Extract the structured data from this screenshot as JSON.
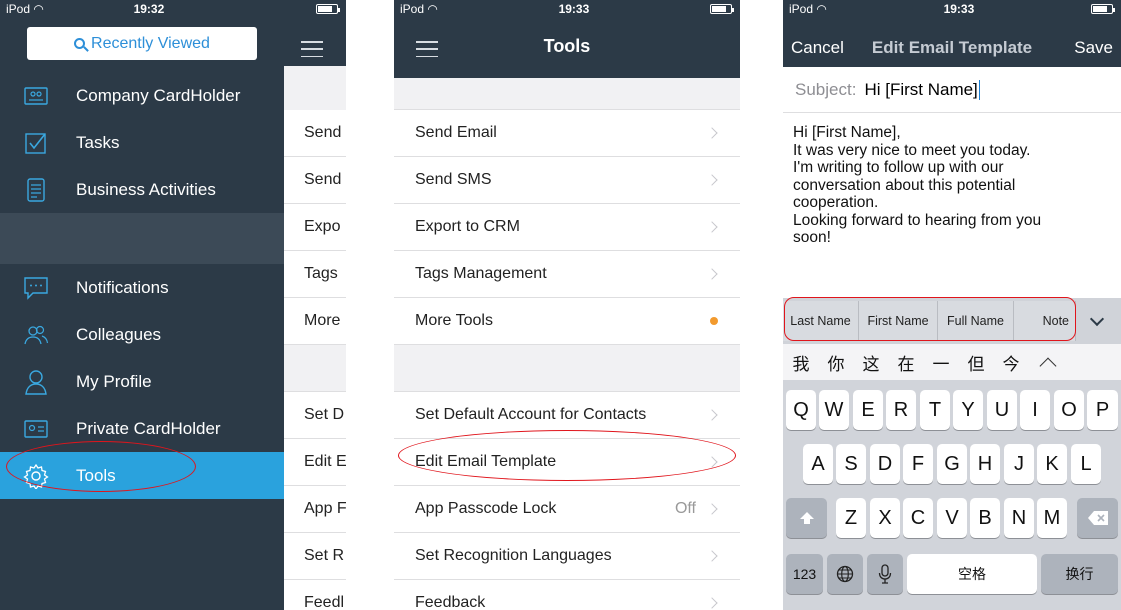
{
  "status_bars": {
    "carrier": "iPod",
    "s1_time": "19:32",
    "s2_time": "19:33",
    "s3_time": "19:33"
  },
  "screen1": {
    "recently_viewed_label": "Recently Viewed",
    "nav_items": [
      {
        "label": "Company CardHolder",
        "icon": "cardholder-icon"
      },
      {
        "label": "Tasks",
        "icon": "checkbox-icon"
      },
      {
        "label": "Business Activities",
        "icon": "document-list-icon"
      },
      {
        "label": "Notifications",
        "icon": "chat-bubble-icon"
      },
      {
        "label": "Colleagues",
        "icon": "people-icon"
      },
      {
        "label": "My Profile",
        "icon": "person-icon"
      },
      {
        "label": "Private CardHolder",
        "icon": "id-card-icon"
      },
      {
        "label": "Tools",
        "icon": "gear-icon",
        "active": true
      }
    ],
    "peek_rows": [
      "Send",
      "Send",
      "Expo",
      "Tags",
      "More",
      "Set D",
      "Edit E",
      "App F",
      "Set R",
      "Feedl"
    ]
  },
  "screen2": {
    "title": "Tools",
    "group1": [
      {
        "label": "Send Email"
      },
      {
        "label": "Send SMS"
      },
      {
        "label": "Export to CRM"
      },
      {
        "label": "Tags Management"
      },
      {
        "label": "More Tools",
        "badge": "dot"
      }
    ],
    "group2": [
      {
        "label": "Set Default Account for Contacts"
      },
      {
        "label": "Edit Email Template"
      },
      {
        "label": "App Passcode Lock",
        "value": "Off"
      },
      {
        "label": "Set Recognition Languages"
      },
      {
        "label": "Feedback"
      }
    ],
    "accent_dot_color": "#f29a2e"
  },
  "screen3": {
    "cancel_label": "Cancel",
    "title": "Edit Email Template",
    "save_label": "Save",
    "subject_label": "Subject:",
    "subject_value": "Hi [First Name]",
    "body_lines": [
      "Hi [First Name],",
      "It was very nice to meet you today.",
      "I'm writing to follow up with our",
      "conversation about this potential",
      "cooperation.",
      "Looking forward to hearing from you",
      "soon!"
    ],
    "chips": [
      "Last Name",
      "First Name",
      "Full Name",
      "Note"
    ],
    "candidates": [
      "我",
      "你",
      "这",
      "在",
      "一",
      "但",
      "今"
    ],
    "keyboard": {
      "row1": [
        "Q",
        "W",
        "E",
        "R",
        "T",
        "Y",
        "U",
        "I",
        "O",
        "P"
      ],
      "row2": [
        "A",
        "S",
        "D",
        "F",
        "G",
        "H",
        "J",
        "K",
        "L"
      ],
      "row3": [
        "Z",
        "X",
        "C",
        "V",
        "B",
        "N",
        "M"
      ],
      "numbers_key": "123",
      "space_key": "空格",
      "return_key": "换行"
    }
  },
  "colors": {
    "drawer_bg": "#2c3a47",
    "active_bg": "#2aa2dd",
    "icon_blue": "#3aa8e0",
    "annotation_red": "#e0151c"
  }
}
